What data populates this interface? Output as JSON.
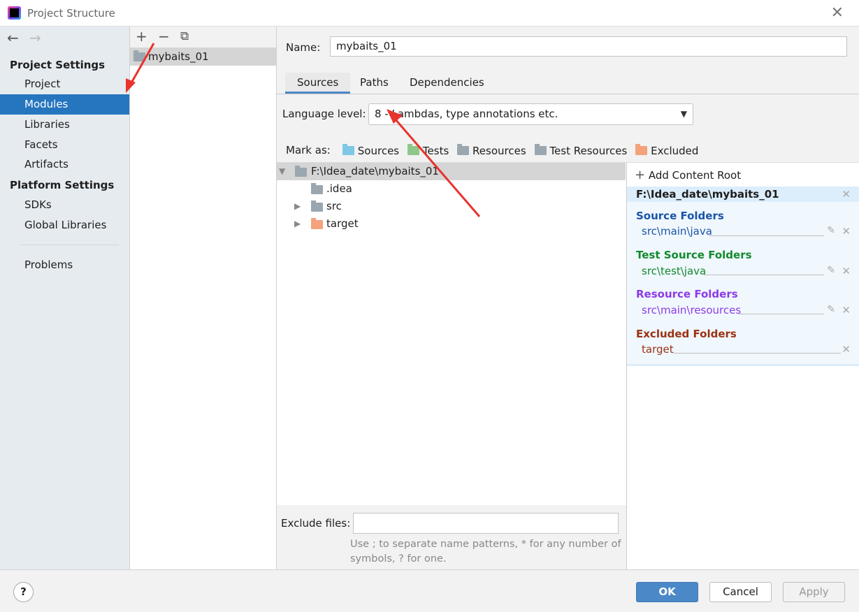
{
  "window": {
    "title": "Project Structure",
    "close": "✕"
  },
  "sidebar": {
    "back": "←",
    "forward": "→",
    "project_settings": "Project Settings",
    "platform_settings": "Platform Settings",
    "items": [
      "Project",
      "Modules",
      "Libraries",
      "Facets",
      "Artifacts"
    ],
    "platform_items": [
      "SDKs",
      "Global Libraries"
    ],
    "problems": "Problems",
    "selected": "Modules"
  },
  "modules": {
    "add": "+",
    "remove": "−",
    "copy": "⧉",
    "list": [
      "mybaits_01"
    ]
  },
  "main": {
    "name_label": "Name:",
    "name_value": "mybaits_01",
    "tabs": [
      "Sources",
      "Paths",
      "Dependencies"
    ],
    "active_tab": "Sources",
    "language_label": "Language level:",
    "language_value": "8 - Lambdas, type annotations etc.",
    "mark_as": "Mark as:",
    "marks": [
      "Sources",
      "Tests",
      "Resources",
      "Test Resources",
      "Excluded"
    ],
    "tree": [
      "F:\\Idea_date\\mybaits_01",
      ".idea",
      "src",
      "target"
    ],
    "exclude_label": "Exclude files:",
    "exclude_value": "",
    "exclude_hint": "Use ; to separate name patterns, * for any number of symbols, ? for one."
  },
  "roots": {
    "add": "Add Content Root",
    "root": "F:\\Idea_date\\mybaits_01",
    "groups": [
      {
        "title": "Source Folders",
        "path": "src\\main\\java",
        "color": "#1a55a6"
      },
      {
        "title": "Test Source Folders",
        "path": "src\\test\\java",
        "color": "#128a2e"
      },
      {
        "title": "Resource Folders",
        "path": "src\\main\\resources",
        "color": "#8c3be8"
      },
      {
        "title": "Excluded Folders",
        "path": "target",
        "color": "#9a3212"
      }
    ]
  },
  "footer": {
    "help": "?",
    "ok": "OK",
    "cancel": "Cancel",
    "apply": "Apply"
  },
  "colors": {
    "accent": "#2675bf",
    "ok_button": "#4a88c7"
  }
}
